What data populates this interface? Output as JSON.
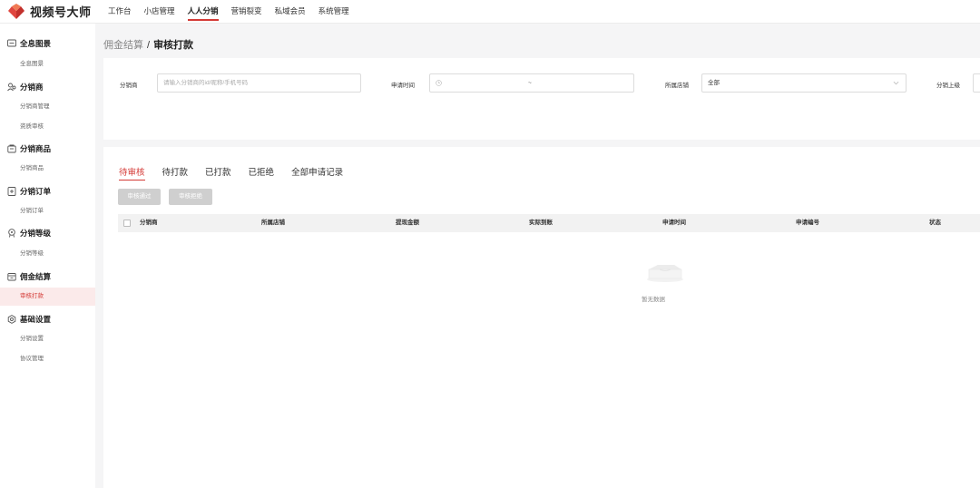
{
  "app": {
    "name": "视频号大师"
  },
  "topnav": [
    {
      "label": "工作台",
      "active": false
    },
    {
      "label": "小店管理",
      "active": false
    },
    {
      "label": "人人分销",
      "active": true
    },
    {
      "label": "营销裂变",
      "active": false
    },
    {
      "label": "私域会员",
      "active": false
    },
    {
      "label": "系统管理",
      "active": false
    }
  ],
  "sidebar": {
    "groups": [
      {
        "label": "全息图景",
        "icon": "overview-icon",
        "items": [
          "全息图景"
        ]
      },
      {
        "label": "分销商",
        "icon": "users-icon",
        "items": [
          "分销商管理",
          "资质审核"
        ]
      },
      {
        "label": "分销商品",
        "icon": "product-icon",
        "items": [
          "分销商品"
        ]
      },
      {
        "label": "分销订单",
        "icon": "order-icon",
        "items": [
          "分销订单"
        ]
      },
      {
        "label": "分销等级",
        "icon": "level-icon",
        "items": [
          "分销等级"
        ]
      },
      {
        "label": "佣金结算",
        "icon": "settlement-icon",
        "items": [
          "审核打款"
        ]
      },
      {
        "label": "基础设置",
        "icon": "gear-icon",
        "items": [
          "分销设置",
          "协议管理"
        ]
      }
    ],
    "active_item": "审核打款"
  },
  "breadcrumb": {
    "parent": "佣金结算",
    "separator": "/",
    "current": "审核打款"
  },
  "filters": {
    "distributor_label": "分销商",
    "distributor_placeholder": "请输入分销商的id/昵称/手机号码",
    "time_label": "申请时间",
    "time_separator": "~",
    "store_label": "所属店铺",
    "store_value": "全部",
    "superior_label": "分销上级"
  },
  "tabs": [
    {
      "label": "待审核",
      "active": true
    },
    {
      "label": "待打款",
      "active": false
    },
    {
      "label": "已打款",
      "active": false
    },
    {
      "label": "已拒绝",
      "active": false
    },
    {
      "label": "全部申请记录",
      "active": false
    }
  ],
  "actions": {
    "approve": "审核通过",
    "reject": "审核拒绝"
  },
  "table": {
    "columns": [
      "分销商",
      "所属店铺",
      "提现金额",
      "实际到账",
      "申请时间",
      "申请编号",
      "状态"
    ]
  },
  "empty_text": "暂无数据",
  "colors": {
    "accent": "#d43a36",
    "background": "#f5f5f6",
    "button_disabled": "#cfcfcf"
  }
}
